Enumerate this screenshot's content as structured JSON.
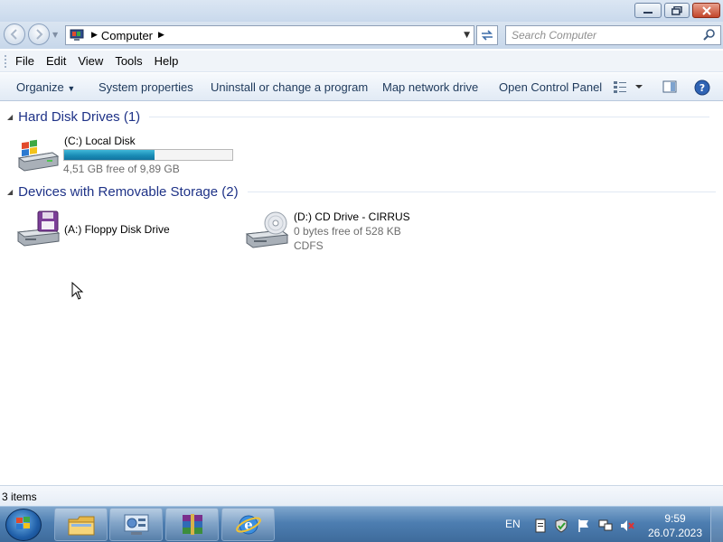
{
  "window": {
    "controls": [
      "minimize",
      "maximize",
      "close"
    ]
  },
  "navigation": {
    "address_path": "Computer",
    "search_placeholder": "Search Computer"
  },
  "menu": {
    "items": [
      "File",
      "Edit",
      "View",
      "Tools",
      "Help"
    ]
  },
  "toolbar": {
    "organize": "Organize",
    "system_properties": "System properties",
    "uninstall": "Uninstall or change a program",
    "map_drive": "Map network drive",
    "control_panel": "Open Control Panel"
  },
  "groups": {
    "hard_disks": {
      "title": "Hard Disk Drives (1)",
      "drives": [
        {
          "name": "(C:) Local Disk",
          "free_text": "4,51 GB free of 9,89 GB",
          "used_fraction": 0.54,
          "icon": "windows-hard-drive-icon"
        }
      ]
    },
    "removable": {
      "title": "Devices with Removable Storage (2)",
      "drives": [
        {
          "name": "(A:) Floppy Disk Drive",
          "icon": "floppy-drive-icon"
        },
        {
          "name": "(D:) CD Drive - CIRRUS",
          "free_text": "0 bytes free of 528 KB",
          "filesystem": "CDFS",
          "icon": "cd-drive-icon"
        }
      ]
    }
  },
  "status": {
    "item_count": "3 items"
  },
  "taskbar": {
    "pinned": [
      "windows-explorer-icon",
      "control-panel-icon",
      "winrar-icon",
      "internet-explorer-icon"
    ],
    "language": "EN",
    "time": "9:59",
    "date": "26.07.2023"
  },
  "colors": {
    "group_title": "#1e3287",
    "disk_bar": "#1a8db6",
    "taskbar": "#4d7eb1"
  }
}
